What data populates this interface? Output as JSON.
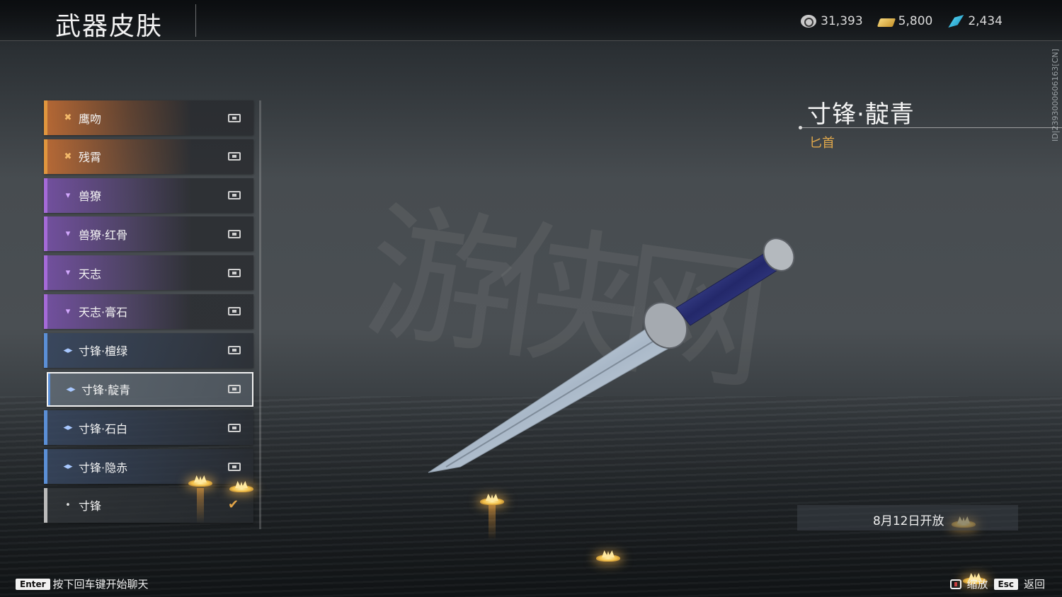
{
  "header": {
    "title": "武器皮肤",
    "currencies": [
      {
        "icon": "coin-icon",
        "value": "31,393"
      },
      {
        "icon": "gold-ingot-icon",
        "value": "5,800"
      },
      {
        "icon": "jade-feather-icon",
        "value": "2,434"
      }
    ]
  },
  "side_id": "ID|2393000606163[CN]",
  "skin_list": [
    {
      "label": "鹰吻",
      "rarity": "orange",
      "status": "locked"
    },
    {
      "label": "残霄",
      "rarity": "orange",
      "status": "locked"
    },
    {
      "label": "兽獠",
      "rarity": "purple",
      "status": "locked"
    },
    {
      "label": "兽獠·红骨",
      "rarity": "purple",
      "status": "locked"
    },
    {
      "label": "天志",
      "rarity": "purple",
      "status": "locked"
    },
    {
      "label": "天志·膏石",
      "rarity": "purple",
      "status": "locked"
    },
    {
      "label": "寸锋·檀绿",
      "rarity": "blue",
      "status": "locked"
    },
    {
      "label": "寸锋·靛青",
      "rarity": "blue",
      "status": "locked",
      "selected": true
    },
    {
      "label": "寸锋·石白",
      "rarity": "blue",
      "status": "locked"
    },
    {
      "label": "寸锋·隐赤",
      "rarity": "blue",
      "status": "locked"
    },
    {
      "label": "寸锋",
      "rarity": "grey",
      "status": "equipped"
    }
  ],
  "weapon": {
    "name": "寸锋·靛青",
    "type": "匕首"
  },
  "release": {
    "text": "8月12日开放"
  },
  "footer": {
    "chat_key": "Enter",
    "chat_hint": "按下回车键开始聊天",
    "zoom_label": "缩放",
    "back_key": "Esc",
    "back_label": "返回"
  },
  "colors": {
    "orange_rarity": "#e0963e",
    "purple_rarity": "#a56ad8",
    "blue_rarity": "#5b8fd6",
    "weapon_type": "#e0a84b"
  }
}
